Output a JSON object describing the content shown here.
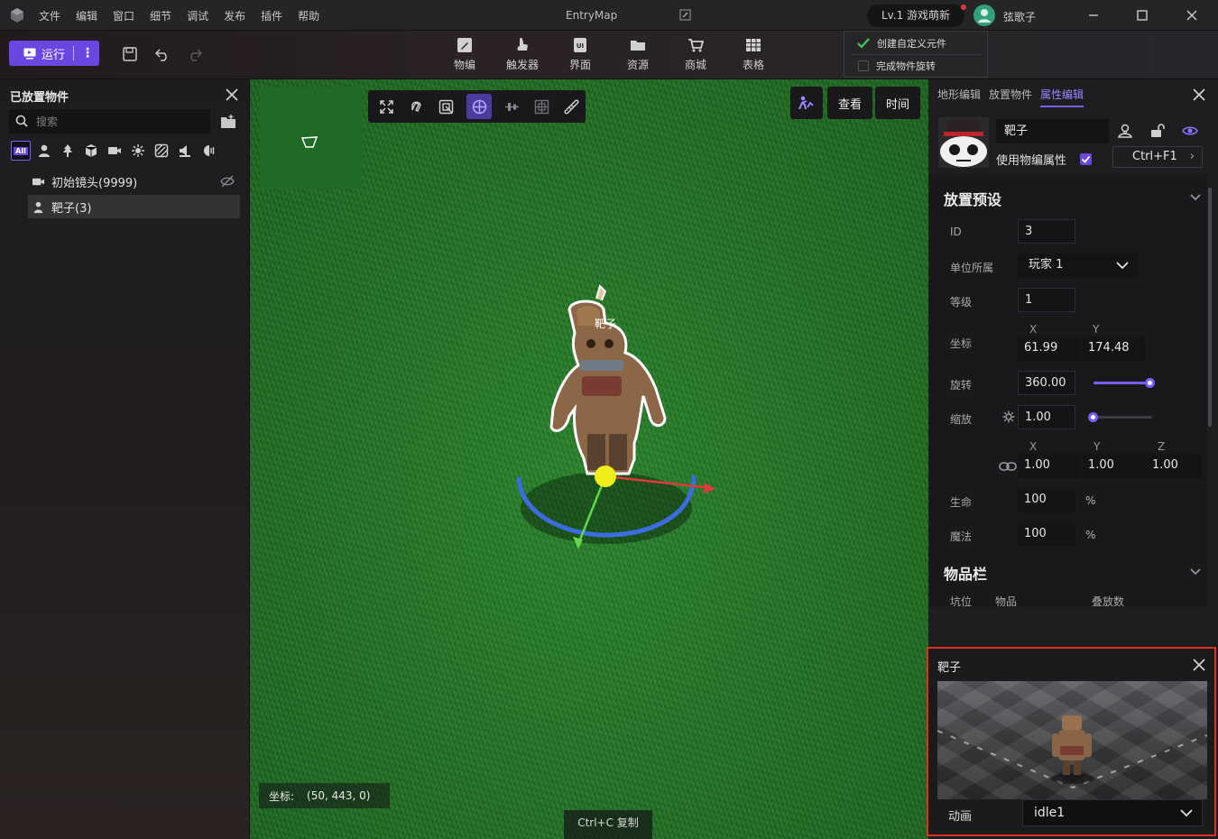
{
  "titlebar": {
    "menus": [
      "文件",
      "编辑",
      "窗口",
      "细节",
      "调试",
      "发布",
      "插件",
      "帮助"
    ],
    "app_title": "EntryMap",
    "level_badge": "Lv.1 游戏萌新",
    "user_name": "弦歌子"
  },
  "toolbar": {
    "run_label": "运行",
    "tools": [
      {
        "label": "物编",
        "icon": "object-edit-icon"
      },
      {
        "label": "触发器",
        "icon": "trigger-icon"
      },
      {
        "label": "界面",
        "icon": "ui-icon"
      },
      {
        "label": "资源",
        "icon": "folder-icon"
      },
      {
        "label": "商城",
        "icon": "shop-icon"
      },
      {
        "label": "表格",
        "icon": "table-icon"
      }
    ],
    "popup": {
      "item1": "创建自定义元件",
      "item1_checked": true,
      "item2": "完成物件旋转",
      "item2_checked": false
    }
  },
  "left_panel": {
    "title": "已放置物件",
    "search_placeholder": "搜索",
    "filter_all": "All",
    "objects": [
      {
        "name": "初始镜头(9999)",
        "icon": "camera-icon",
        "selected": false
      },
      {
        "name": "靶子(3)",
        "icon": "unit-icon",
        "selected": true
      }
    ]
  },
  "viewport": {
    "view_button": "查看",
    "time_button": "时间",
    "unit_label": "靶子",
    "coord_key": "坐标:",
    "coord_value": "(50, 443, 0)",
    "copy_hint": "Ctrl+C 复制"
  },
  "right_panel": {
    "tabs": [
      "地形编辑",
      "放置物件",
      "属性编辑"
    ],
    "active_tab": "属性编辑",
    "object_name": "靶子",
    "use_object_attr": "使用物编属性",
    "use_object_attr_checked": true,
    "hotkey": "Ctrl+F1",
    "preset_section": "放置预设",
    "fields": {
      "id_label": "ID",
      "id_value": "3",
      "owner_label": "单位所属",
      "owner_value": "玩家 1",
      "level_label": "等级",
      "level_value": "1",
      "pos_label": "坐标",
      "pos_x_axis": "X",
      "pos_y_axis": "Y",
      "pos_x": "61.99",
      "pos_y": "174.48",
      "rot_label": "旋转",
      "rot_value": "360.00",
      "rot_slider_fraction": 1.0,
      "scale_label": "缩放",
      "scale_value": "1.00",
      "scale_slider_fraction": 0.0,
      "scale_x_axis": "X",
      "scale_y_axis": "Y",
      "scale_z_axis": "Z",
      "scale_x": "1.00",
      "scale_y": "1.00",
      "scale_z": "1.00",
      "hp_label": "生命",
      "hp_value": "100",
      "hp_unit": "%",
      "mp_label": "魔法",
      "mp_value": "100",
      "mp_unit": "%"
    },
    "inventory_section": "物品栏",
    "inventory_columns": [
      "坑位",
      "物品",
      "叠放数"
    ]
  },
  "preview": {
    "title": "靶子",
    "anim_label": "动画",
    "anim_value": "idle1"
  },
  "colors": {
    "accent": "#6a47e0",
    "highlight_border": "#e0301e"
  }
}
